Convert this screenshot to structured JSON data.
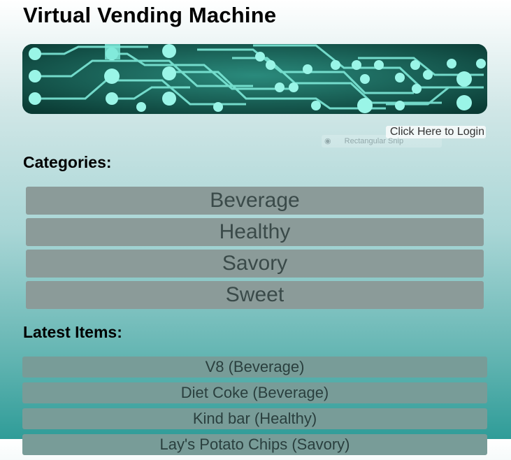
{
  "header": {
    "title": "Virtual Vending Machine"
  },
  "banner": {
    "image": "circuit-board-banner",
    "colors": {
      "base": "#0f4a42",
      "trace": "#7ee8d8"
    }
  },
  "auth": {
    "login_label": "Click Here to Login"
  },
  "overlay": {
    "snip_label": "Rectangular Snip",
    "icon": "snip-icon"
  },
  "categories": {
    "heading": "Categories:",
    "items": [
      {
        "label": "Beverage"
      },
      {
        "label": "Healthy"
      },
      {
        "label": "Savory"
      },
      {
        "label": "Sweet"
      }
    ]
  },
  "latest": {
    "heading": "Latest Items:",
    "items": [
      {
        "label": "V8 (Beverage)"
      },
      {
        "label": "Diet Coke (Beverage)"
      },
      {
        "label": "Kind bar (Healthy)"
      },
      {
        "label": "Lay's Potato Chips (Savory)"
      }
    ]
  },
  "colors": {
    "category_button": "#8b9b99",
    "item_row": "#789c98",
    "background_top": "#ffffff",
    "background_bottom": "#2f9c98"
  }
}
